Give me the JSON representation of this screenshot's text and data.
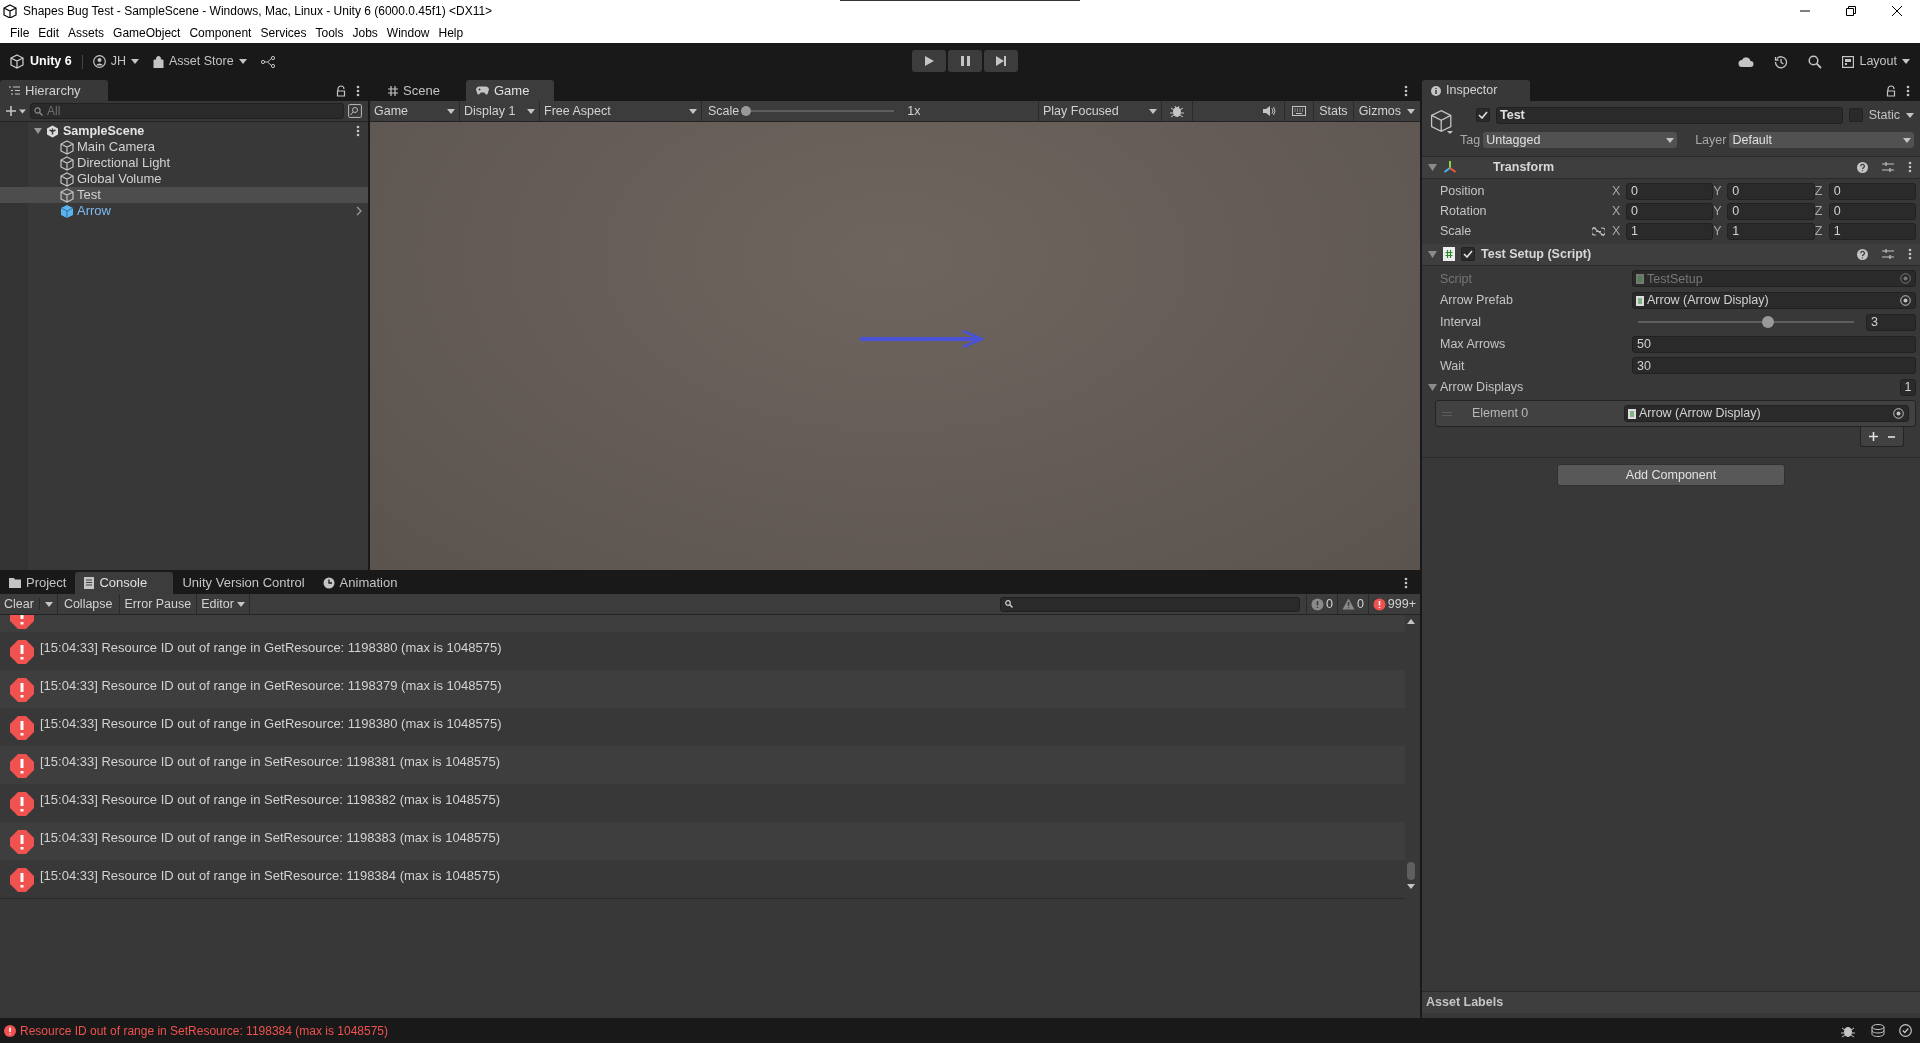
{
  "window": {
    "title": "Shapes Bug Test - SampleScene - Windows, Mac, Linux - Unity 6 (6000.0.45f1) <DX11>"
  },
  "menu": [
    "File",
    "Edit",
    "Assets",
    "GameObject",
    "Component",
    "Services",
    "Tools",
    "Jobs",
    "Window",
    "Help"
  ],
  "toolbar": {
    "product": "Unity 6",
    "account": "JH",
    "asset_store": "Asset Store",
    "layout": "Layout"
  },
  "hierarchy": {
    "tab": "Hierarchy",
    "search_placeholder": "All",
    "scene": "SampleScene",
    "items": [
      {
        "label": "Main Camera",
        "kind": "object",
        "selected": false
      },
      {
        "label": "Directional Light",
        "kind": "object",
        "selected": false
      },
      {
        "label": "Global Volume",
        "kind": "object",
        "selected": false
      },
      {
        "label": "Test",
        "kind": "object",
        "selected": true
      },
      {
        "label": "Arrow",
        "kind": "prefab",
        "selected": false
      }
    ]
  },
  "game": {
    "tabs": [
      {
        "label": "Scene",
        "kind": "scene",
        "selected": false
      },
      {
        "label": "Game",
        "kind": "game",
        "selected": true
      }
    ],
    "view": "Game",
    "display": "Display 1",
    "aspect": "Free Aspect",
    "scale": {
      "label": "Scale",
      "level": 0,
      "value": "1x"
    },
    "play_focused": "Play Focused",
    "stats": "Stats",
    "gizmos": "Gizmos"
  },
  "inspector": {
    "tab": "Inspector",
    "object": {
      "active": true,
      "name": "Test",
      "static": false,
      "static_label": "Static",
      "tag_label": "Tag",
      "tag": "Untagged",
      "layer_label": "Layer",
      "layer": "Default"
    },
    "components": [
      {
        "kind": "transform",
        "title": "Transform",
        "expanded": true,
        "rows": [
          {
            "label": "Position",
            "values": [
              {
                "axis": "X",
                "value": "0"
              },
              {
                "axis": "Y",
                "value": "0"
              },
              {
                "axis": "Z",
                "value": "0"
              }
            ]
          },
          {
            "label": "Rotation",
            "values": [
              {
                "axis": "X",
                "value": "0"
              },
              {
                "axis": "Y",
                "value": "0"
              },
              {
                "axis": "Z",
                "value": "0"
              }
            ]
          },
          {
            "label": "Scale",
            "constrained": false,
            "values": [
              {
                "axis": "X",
                "value": "1"
              },
              {
                "axis": "Y",
                "value": "1"
              },
              {
                "axis": "Z",
                "value": "1"
              }
            ]
          }
        ]
      },
      {
        "kind": "script",
        "title": "Test Setup (Script)",
        "expanded": true,
        "enabled": true,
        "fields": [
          {
            "kind": "object",
            "label": "Script",
            "value": "TestSetup",
            "disabled": true
          },
          {
            "kind": "object",
            "label": "Arrow Prefab",
            "value": "Arrow (Arrow Display)",
            "disabled": false
          },
          {
            "kind": "slider",
            "label": "Interval",
            "level": 0.6,
            "value": "3"
          },
          {
            "kind": "number",
            "label": "Max Arrows",
            "value": "50"
          },
          {
            "kind": "number",
            "label": "Wait",
            "value": "30"
          },
          {
            "kind": "list",
            "label": "Arrow Displays",
            "expanded": true,
            "count": "1",
            "elements": [
              {
                "label": "Element 0",
                "value": "Arrow (Arrow Display)"
              }
            ]
          }
        ]
      }
    ],
    "add_component": "Add Component",
    "asset_labels": "Asset Labels"
  },
  "console": {
    "tabs": [
      {
        "label": "Project",
        "kind": "folder",
        "selected": false
      },
      {
        "label": "Console",
        "kind": "console",
        "selected": true
      },
      {
        "label": "Unity Version Control",
        "kind": "none",
        "selected": false
      },
      {
        "label": "Animation",
        "kind": "clock",
        "selected": false
      }
    ],
    "clear": "Clear",
    "collapse": "Collapse",
    "error_pause": "Error Pause",
    "editor": "Editor",
    "info_count": "0",
    "warning_count": "0",
    "error_count": "999+",
    "logs": [
      {
        "text": "[15:04:33] Resource ID out of range in GetResource: 1198380 (max is 1048575)"
      },
      {
        "text": "[15:04:33] Resource ID out of range in GetResource: 1198379 (max is 1048575)"
      },
      {
        "text": "[15:04:33] Resource ID out of range in GetResource: 1198380 (max is 1048575)"
      },
      {
        "text": "[15:04:33] Resource ID out of range in SetResource: 1198381 (max is 1048575)"
      },
      {
        "text": "[15:04:33] Resource ID out of range in SetResource: 1198382 (max is 1048575)"
      },
      {
        "text": "[15:04:33] Resource ID out of range in SetResource: 1198383 (max is 1048575)"
      },
      {
        "text": "[15:04:33] Resource ID out of range in SetResource: 1198384 (max is 1048575)"
      }
    ]
  },
  "status_bar": {
    "message": "Resource ID out of range in SetResource: 1198384 (max is 1048575)"
  }
}
